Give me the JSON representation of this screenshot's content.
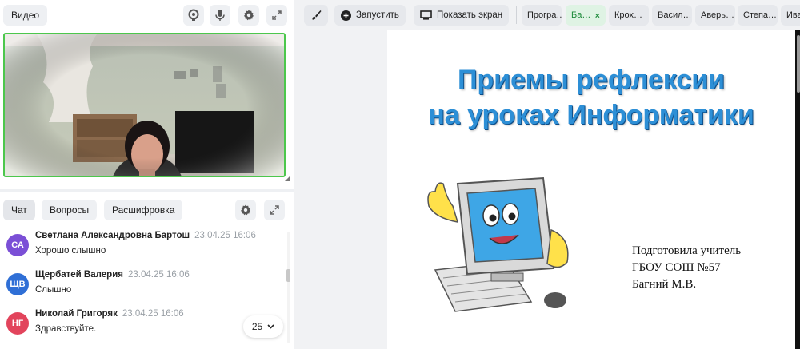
{
  "video_panel": {
    "title": "Видео",
    "icons": [
      "camera-icon",
      "microphone-icon",
      "gear-icon",
      "expand-icon"
    ]
  },
  "chat_panel": {
    "tabs": [
      "Чат",
      "Вопросы",
      "Расшифровка"
    ],
    "active_tab": "Чат",
    "messages": [
      {
        "initials": "СА",
        "avatar_color": "#7b4fd6",
        "name": "Светлана Александровна Бартош",
        "time": "23.04.25 16:06",
        "text": "Хорошо слышно"
      },
      {
        "initials": "ЩВ",
        "avatar_color": "#2f6fd6",
        "name": "Щербатей Валерия",
        "time": "23.04.25 16:06",
        "text": "Слышно"
      },
      {
        "initials": "НГ",
        "avatar_color": "#e2445c",
        "name": "Николай Григоряк",
        "time": "23.04.25 16:06",
        "text": "Здравствуйте."
      }
    ],
    "unread_counter": "25"
  },
  "toolbar": {
    "start_label": "Запустить",
    "share_screen_label": "Показать экран",
    "presentation_tabs": [
      {
        "label": "Програ…",
        "active": false
      },
      {
        "label": "Ба…",
        "active": true
      },
      {
        "label": "Крох…",
        "active": false
      },
      {
        "label": "Васил…",
        "active": false
      },
      {
        "label": "Аверь…",
        "active": false
      },
      {
        "label": "Степа…",
        "active": false
      },
      {
        "label": "Ива",
        "active": false
      }
    ]
  },
  "slide": {
    "title_line1": "Приемы рефлексии",
    "title_line2": "на уроках Информатики",
    "author_line1": "Подготовила учитель",
    "author_line2": "ГБОУ СОШ №57",
    "author_line3": "Багний М.В."
  },
  "colors": {
    "accent_green": "#4cc74c",
    "title_blue": "#2d8fd6"
  }
}
